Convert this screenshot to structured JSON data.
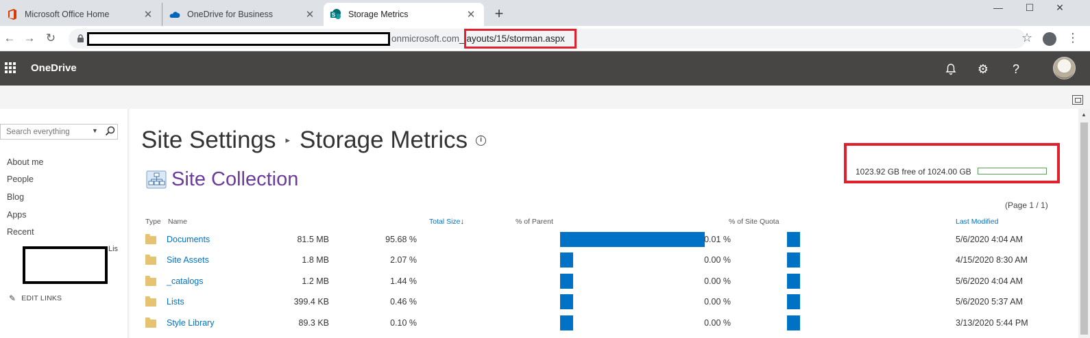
{
  "browser": {
    "tabs": [
      {
        "label": "Microsoft Office Home",
        "icon": "office-icon",
        "active": false
      },
      {
        "label": "OneDrive for Business",
        "icon": "onedrive-cloud-icon",
        "active": false
      },
      {
        "label": "Storage Metrics",
        "icon": "sharepoint-icon",
        "active": true
      }
    ],
    "new_tab": "+",
    "url_host": "onmicrosoft.com",
    "url_path": "_layouts/15/storman.aspx"
  },
  "suitebar": {
    "app_name": "OneDrive"
  },
  "search": {
    "placeholder": "Search everything"
  },
  "nav": {
    "links": [
      "About me",
      "People",
      "Blog",
      "Apps",
      "Recent"
    ],
    "recent_tail": "Lis",
    "edit_links": "EDIT LINKS"
  },
  "page": {
    "breadcrumb_parent": "Site Settings",
    "title": "Storage Metrics",
    "section": "Site Collection",
    "quota_text": "1023.92 GB free of 1024.00 GB",
    "quota_free_fraction": 0.99992,
    "page_info": "(Page 1 / 1)"
  },
  "table": {
    "headers": {
      "type": "Type",
      "name": "Name",
      "total_size": "Total Size",
      "pct_parent": "% of Parent",
      "pct_quota": "% of Site Quota",
      "last_modified": "Last Modified"
    },
    "rows": [
      {
        "name": "Documents",
        "size": "81.5 MB",
        "pct_parent": "95.68 %",
        "parent_value": 95.68,
        "pct_quota": "0.01 %",
        "quota_value": 0.01,
        "modified": "5/6/2020 4:04 AM"
      },
      {
        "name": "Site Assets",
        "size": "1.8 MB",
        "pct_parent": "2.07 %",
        "parent_value": 2.07,
        "pct_quota": "0.00 %",
        "quota_value": 0.0,
        "modified": "4/15/2020 8:30 AM"
      },
      {
        "name": "_catalogs",
        "size": "1.2 MB",
        "pct_parent": "1.44 %",
        "parent_value": 1.44,
        "pct_quota": "0.00 %",
        "quota_value": 0.0,
        "modified": "5/6/2020 4:04 AM"
      },
      {
        "name": "Lists",
        "size": "399.4 KB",
        "pct_parent": "0.46 %",
        "parent_value": 0.46,
        "pct_quota": "0.00 %",
        "quota_value": 0.0,
        "modified": "5/6/2020 5:37 AM"
      },
      {
        "name": "Style Library",
        "size": "89.3 KB",
        "pct_parent": "0.10 %",
        "parent_value": 0.1,
        "pct_quota": "0.00 %",
        "quota_value": 0.0,
        "modified": "3/13/2020 5:44 PM"
      }
    ]
  },
  "colors": {
    "accent": "#0072c6",
    "suite_bar": "#484644",
    "section_title": "#6b3b9c",
    "highlight": "#e0202d",
    "quota_bar": "#5a9e5a"
  }
}
